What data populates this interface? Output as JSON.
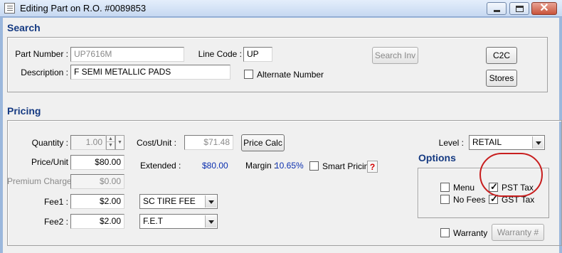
{
  "window": {
    "title": "Editing Part on R.O. #0089853",
    "close_glyph": "✕"
  },
  "search": {
    "section_title": "Search",
    "part_number_label": "Part Number :",
    "part_number_value": "UP7616M",
    "line_code_label": "Line Code :",
    "line_code_value": "UP",
    "description_label": "Description :",
    "description_value": "F SEMI METALLIC PADS",
    "alternate_number_label": "Alternate Number",
    "alternate_number_checked": false,
    "search_inv_button": "Search Inv",
    "c2c_button": "C2C",
    "stores_button": "Stores"
  },
  "pricing": {
    "section_title": "Pricing",
    "quantity_label": "Quantity :",
    "quantity_value": "1.00",
    "cost_unit_label": "Cost/Unit :",
    "cost_unit_value": "$71.48",
    "price_calc_button": "Price Calc",
    "price_unit_label": "Price/Unit",
    "price_unit_value": "$80.00",
    "extended_label": "Extended :",
    "extended_value": "$80.00",
    "margin_label": "Margin :",
    "margin_value": "10.65%",
    "smart_pricing_label": "Smart Pricing",
    "smart_pricing_checked": false,
    "help_glyph": "?",
    "premium_charge_label": "Premium Charge",
    "premium_charge_value": "$0.00",
    "fee1_label": "Fee1 :",
    "fee1_value": "$2.00",
    "fee1_select": "SC TIRE FEE",
    "fee2_label": "Fee2 :",
    "fee2_value": "$2.00",
    "fee2_select": "F.E.T",
    "level_label": "Level :",
    "level_select": "RETAIL"
  },
  "options": {
    "section_title": "Options",
    "menu_label": "Menu",
    "menu_checked": false,
    "no_fees_label": "No Fees",
    "no_fees_checked": false,
    "pst_tax_label": "PST Tax",
    "pst_tax_checked": true,
    "gst_tax_label": "GST Tax",
    "gst_tax_checked": true,
    "checkmark_glyph": "✓",
    "warranty_label": "Warranty",
    "warranty_checked": false,
    "warranty_number_button": "Warranty #"
  },
  "colors": {
    "section_title": "#153a82",
    "value_blue": "#0b2fae",
    "highlight_oval": "#c81e1e",
    "help_red": "#d40000"
  }
}
